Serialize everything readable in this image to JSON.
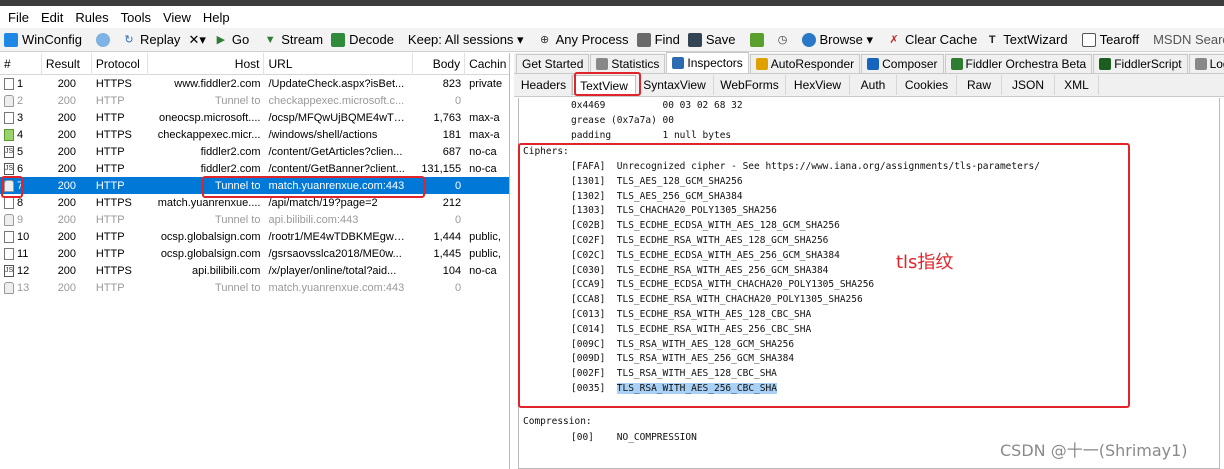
{
  "menu": [
    "File",
    "Edit",
    "Rules",
    "Tools",
    "View",
    "Help"
  ],
  "toolbar": {
    "winconfig": "WinConfig",
    "replay": "Replay",
    "go": "Go",
    "stream": "Stream",
    "decode": "Decode",
    "keep": "Keep: All sessions",
    "process": "Any Process",
    "find": "Find",
    "save": "Save",
    "browse": "Browse",
    "clear_cache": "Clear Cache",
    "textwizard": "TextWizard",
    "tearoff": "Tearoff",
    "msdn": "MSDN Search"
  },
  "grid": {
    "headers": {
      "num": "#",
      "result": "Result",
      "protocol": "Protocol",
      "host": "Host",
      "url": "URL",
      "body": "Body",
      "caching": "Cachin"
    },
    "rows": [
      {
        "num": "1",
        "result": "200",
        "protocol": "HTTPS",
        "host": "www.fiddler2.com",
        "url": "/UpdateCheck.aspx?isBet...",
        "body": "823",
        "caching": "private"
      },
      {
        "num": "2",
        "result": "200",
        "protocol": "HTTP",
        "host": "Tunnel to",
        "url": "checkappexec.microsoft.c...",
        "body": "0",
        "caching": ""
      },
      {
        "num": "3",
        "result": "200",
        "protocol": "HTTP",
        "host": "oneocsp.microsoft....",
        "url": "/ocsp/MFQwUjBQME4wTD...",
        "body": "1,763",
        "caching": "max-a"
      },
      {
        "num": "4",
        "result": "200",
        "protocol": "HTTPS",
        "host": "checkappexec.micr...",
        "url": "/windows/shell/actions",
        "body": "181",
        "caching": "max-a"
      },
      {
        "num": "5",
        "result": "200",
        "protocol": "HTTP",
        "host": "fiddler2.com",
        "url": "/content/GetArticles?clien...",
        "body": "687",
        "caching": "no-ca"
      },
      {
        "num": "6",
        "result": "200",
        "protocol": "HTTP",
        "host": "fiddler2.com",
        "url": "/content/GetBanner?client...",
        "body": "131,155",
        "caching": "no-ca"
      },
      {
        "num": "7",
        "result": "200",
        "protocol": "HTTP",
        "host": "Tunnel to",
        "url": "match.yuanrenxue.com:443",
        "body": "0",
        "caching": ""
      },
      {
        "num": "8",
        "result": "200",
        "protocol": "HTTPS",
        "host": "match.yuanrenxue....",
        "url": "/api/match/19?page=2",
        "body": "212",
        "caching": ""
      },
      {
        "num": "9",
        "result": "200",
        "protocol": "HTTP",
        "host": "Tunnel to",
        "url": "api.bilibili.com:443",
        "body": "0",
        "caching": ""
      },
      {
        "num": "10",
        "result": "200",
        "protocol": "HTTP",
        "host": "ocsp.globalsign.com",
        "url": "/rootr1/ME4wTDBKMEgwR...",
        "body": "1,444",
        "caching": "public,"
      },
      {
        "num": "11",
        "result": "200",
        "protocol": "HTTP",
        "host": "ocsp.globalsign.com",
        "url": "/gsrsaovsslca2018/ME0w...",
        "body": "1,445",
        "caching": "public,"
      },
      {
        "num": "12",
        "result": "200",
        "protocol": "HTTPS",
        "host": "api.bilibili.com",
        "url": "/x/player/online/total?aid...",
        "body": "104",
        "caching": "no-ca"
      },
      {
        "num": "13",
        "result": "200",
        "protocol": "HTTP",
        "host": "Tunnel to",
        "url": "match.yuanrenxue.com:443",
        "body": "0",
        "caching": ""
      }
    ]
  },
  "inspector": {
    "top_tabs": [
      "Get Started",
      "Statistics",
      "Inspectors",
      "AutoResponder",
      "Composer",
      "Fiddler Orchestra Beta",
      "FiddlerScript",
      "Log"
    ],
    "sub_tabs": [
      "Headers",
      "TextView",
      "SyntaxView",
      "WebForms",
      "HexView",
      "Auth",
      "Cookies",
      "Raw",
      "JSON",
      "XML"
    ],
    "text": {
      "l0": "0x4469          00 03 02 68 32",
      "l1": "grease (0x7a7a) 00",
      "l2": "padding         1 null bytes",
      "ciphers_label": "Ciphers:",
      "ciphers": [
        "[FAFA]  Unrecognized cipher - See https://www.iana.org/assignments/tls-parameters/",
        "[1301]  TLS_AES_128_GCM_SHA256",
        "[1302]  TLS_AES_256_GCM_SHA384",
        "[1303]  TLS_CHACHA20_POLY1305_SHA256",
        "[C02B]  TLS_ECDHE_ECDSA_WITH_AES_128_GCM_SHA256",
        "[C02F]  TLS_ECDHE_RSA_WITH_AES_128_GCM_SHA256",
        "[C02C]  TLS_ECDHE_ECDSA_WITH_AES_256_GCM_SHA384",
        "[C030]  TLS_ECDHE_RSA_WITH_AES_256_GCM_SHA384",
        "[CCA9]  TLS_ECDHE_ECDSA_WITH_CHACHA20_POLY1305_SHA256",
        "[CCA8]  TLS_ECDHE_RSA_WITH_CHACHA20_POLY1305_SHA256",
        "[C013]  TLS_ECDHE_RSA_WITH_AES_128_CBC_SHA",
        "[C014]  TLS_ECDHE_RSA_WITH_AES_256_CBC_SHA",
        "[009C]  TLS_RSA_WITH_AES_128_GCM_SHA256",
        "[009D]  TLS_RSA_WITH_AES_256_GCM_SHA384",
        "[002F]  TLS_RSA_WITH_AES_128_CBC_SHA"
      ],
      "last_code": "[0035]  ",
      "last_name": "TLS_RSA_WITH_AES_256_CBC_SHA",
      "compression_label": "Compression:",
      "compression": "[00]    NO_COMPRESSION"
    }
  },
  "annotation": "tls指纹",
  "watermark": "CSDN @十一(Shrimay1)",
  "colors": {
    "selection": "#0078d7",
    "highlight_box": "#e0242a",
    "text_highlight": "#a9d1f5"
  }
}
